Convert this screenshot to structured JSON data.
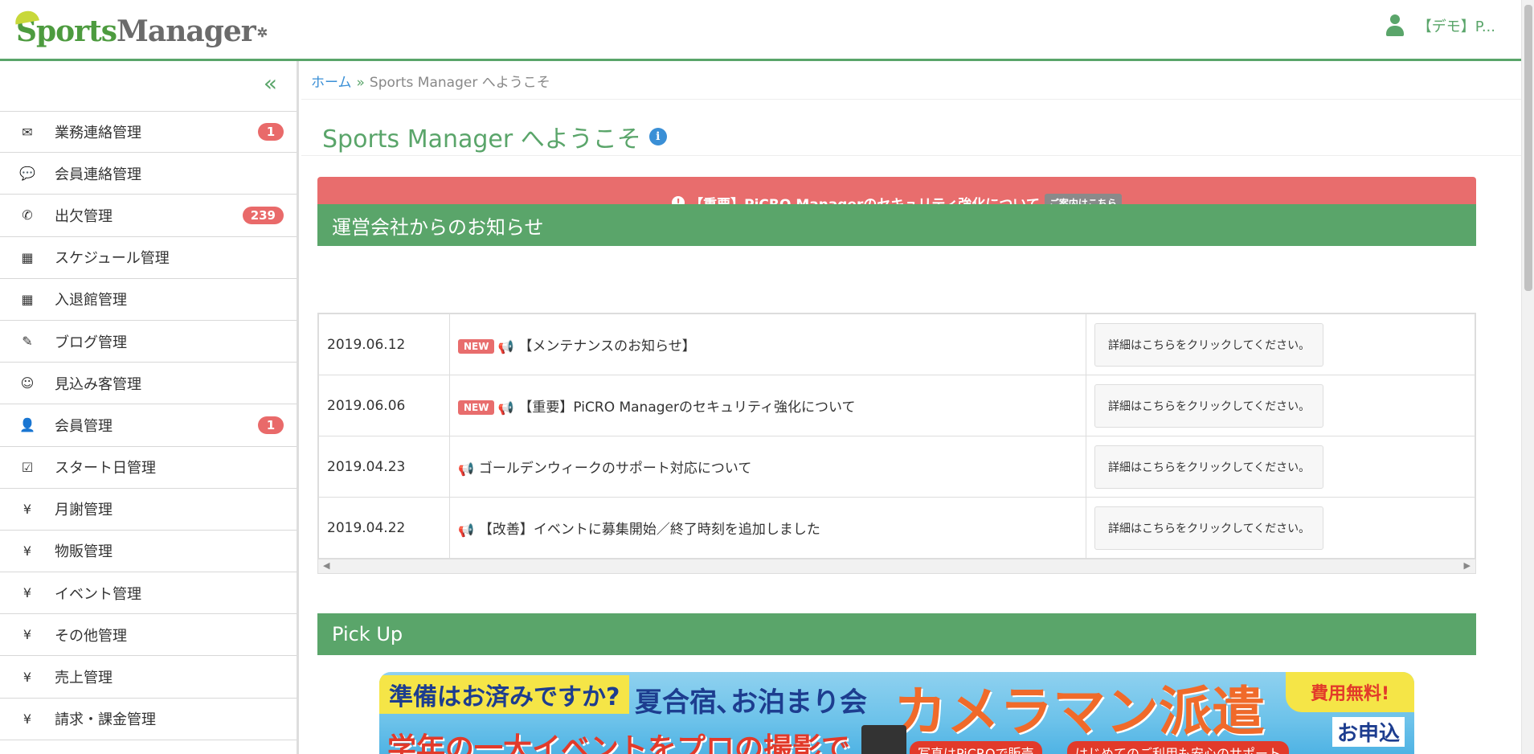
{
  "header": {
    "logo_part1": "Sports",
    "logo_part2": "Manager",
    "user_name": "【デモ】P..."
  },
  "sidebar": {
    "collapse_glyph": "«",
    "items": [
      {
        "label": "業務連絡管理",
        "icon": "envelope-icon",
        "glyph": "✉",
        "badge": "1"
      },
      {
        "label": "会員連絡管理",
        "icon": "comment-icon",
        "glyph": "💬",
        "badge": ""
      },
      {
        "label": "出欠管理",
        "icon": "phone-icon",
        "glyph": "✆",
        "badge": "239"
      },
      {
        "label": "スケジュール管理",
        "icon": "calendar-icon",
        "glyph": "▦",
        "badge": ""
      },
      {
        "label": "入退館管理",
        "icon": "calendar-icon",
        "glyph": "▦",
        "badge": ""
      },
      {
        "label": "ブログ管理",
        "icon": "pencil-icon",
        "glyph": "✎",
        "badge": ""
      },
      {
        "label": "見込み客管理",
        "icon": "smile-icon",
        "glyph": "☺",
        "badge": ""
      },
      {
        "label": "会員管理",
        "icon": "user-icon",
        "glyph": "👤",
        "badge": "1"
      },
      {
        "label": "スタート日管理",
        "icon": "check-square-icon",
        "glyph": "☑",
        "badge": ""
      },
      {
        "label": "月謝管理",
        "icon": "yen-icon",
        "glyph": "¥",
        "badge": ""
      },
      {
        "label": "物販管理",
        "icon": "yen-icon",
        "glyph": "¥",
        "badge": ""
      },
      {
        "label": "イベント管理",
        "icon": "yen-icon",
        "glyph": "¥",
        "badge": ""
      },
      {
        "label": "その他管理",
        "icon": "yen-icon",
        "glyph": "¥",
        "badge": ""
      },
      {
        "label": "売上管理",
        "icon": "yen-icon",
        "glyph": "¥",
        "badge": ""
      },
      {
        "label": "請求・課金管理",
        "icon": "yen-icon",
        "glyph": "¥",
        "badge": ""
      }
    ]
  },
  "breadcrumb": {
    "home": "ホーム",
    "separator": "»",
    "current": "Sports Manager へようこそ"
  },
  "page": {
    "title": "Sports Manager へようこそ"
  },
  "alert": {
    "text": "【重要】PiCRO Managerのセキュリティ強化について",
    "button": "ご案内はこちら",
    "color": "#e86d6d"
  },
  "notice_panel": {
    "title": "運営会社からのお知らせ",
    "new_label": "NEW",
    "rows": [
      {
        "date": "2019.06.12",
        "is_new": true,
        "title": "【メンテナンスのお知らせ】",
        "link": "詳細はこちらをクリックしてください。"
      },
      {
        "date": "2019.06.06",
        "is_new": true,
        "title": "【重要】PiCRO Managerのセキュリティ強化について",
        "link": "詳細はこちらをクリックしてください。"
      },
      {
        "date": "2019.04.23",
        "is_new": false,
        "title": "ゴールデンウィークのサポート対応について",
        "link": "詳細はこちらをクリックしてください。"
      },
      {
        "date": "2019.04.22",
        "is_new": false,
        "title": "【改善】イベントに募集開始／終了時刻を追加しました",
        "link": "詳細はこちらをクリックしてください。"
      }
    ]
  },
  "pickup_panel": {
    "title": "Pick Up"
  },
  "banner": {
    "line1": "準備はお済みですか?",
    "line2": "夏合宿､お泊まり会",
    "headline": "カメラマン派遣",
    "free": "費用無料!",
    "apply": "お申込",
    "line3": "学年の一大イベントをプロの撮影で",
    "pill1": "写真はPiCROで販売",
    "pill2": "はじめてのご利用も安心のサポート"
  },
  "colors": {
    "brand_green": "#5aa56a",
    "link_blue": "#3a8fd6",
    "badge_red": "#e96a6a"
  }
}
